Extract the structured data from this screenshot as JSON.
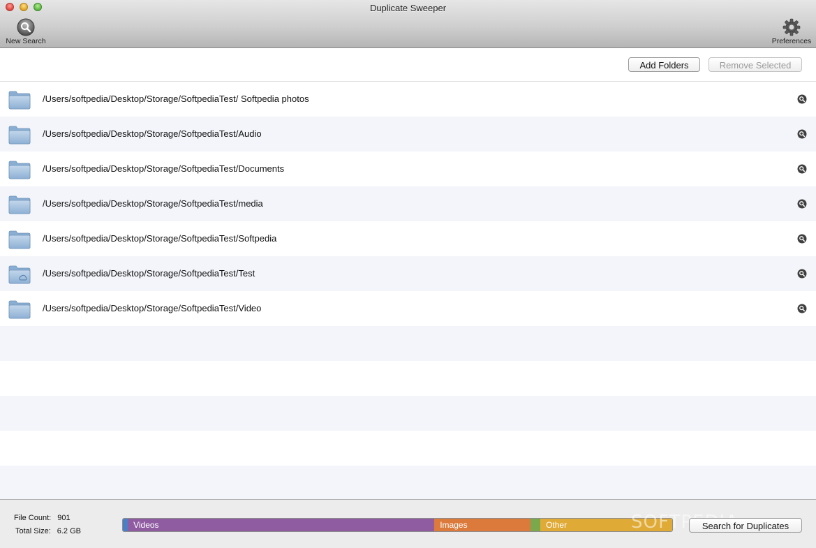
{
  "window": {
    "title": "Duplicate Sweeper"
  },
  "toolbar": {
    "new_search_label": "New Search",
    "preferences_label": "Preferences"
  },
  "actions": {
    "add_folders_label": "Add Folders",
    "remove_selected_label": "Remove Selected"
  },
  "folders": [
    {
      "path": "/Users/softpedia/Desktop/Storage/SoftpediaTest/ Softpedia photos",
      "icon": "folder-icon"
    },
    {
      "path": "/Users/softpedia/Desktop/Storage/SoftpediaTest/Audio",
      "icon": "folder-icon"
    },
    {
      "path": "/Users/softpedia/Desktop/Storage/SoftpediaTest/Documents",
      "icon": "folder-icon"
    },
    {
      "path": "/Users/softpedia/Desktop/Storage/SoftpediaTest/media",
      "icon": "folder-icon"
    },
    {
      "path": "/Users/softpedia/Desktop/Storage/SoftpediaTest/Softpedia",
      "icon": "folder-icon"
    },
    {
      "path": "/Users/softpedia/Desktop/Storage/SoftpediaTest/Test",
      "icon": "cloud-folder-icon"
    },
    {
      "path": "/Users/softpedia/Desktop/Storage/SoftpediaTest/Video",
      "icon": "folder-icon"
    }
  ],
  "stats": {
    "file_count_label": "File Count:",
    "file_count_value": "901",
    "total_size_label": "Total Size:",
    "total_size_value": "6.2 GB"
  },
  "file_types": [
    {
      "label": "",
      "share": 0.009,
      "color": "#4a7fc6"
    },
    {
      "label": "Videos",
      "share": 0.558,
      "color": "#8f5ca2"
    },
    {
      "label": "Images",
      "share": 0.175,
      "color": "#dc7a3c"
    },
    {
      "label": "",
      "share": 0.018,
      "color": "#79a84d"
    },
    {
      "label": "Other",
      "share": 0.24,
      "color": "#dfaa36"
    }
  ],
  "watermark": "SOFTPEDIA",
  "search_button_label": "Search for Duplicates"
}
